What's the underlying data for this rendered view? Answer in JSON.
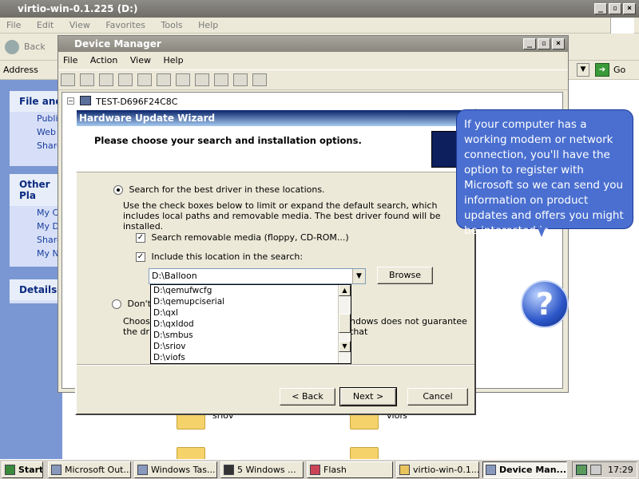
{
  "explorer": {
    "title": "virtio-win-0.1.225 (D:)",
    "menu": [
      "File",
      "Edit",
      "View",
      "Favorites",
      "Tools",
      "Help"
    ],
    "back_label": "Back",
    "address_label": "Address",
    "go_label": "Go",
    "file_tasks_title": "File and",
    "file_tasks": [
      "Publis",
      "Web",
      "Share"
    ],
    "other_places_title": "Other Pla",
    "other_places": [
      "My C",
      "My D",
      "Share",
      "My N"
    ],
    "details_title": "Details",
    "folders": [
      "sriov",
      "viofs"
    ]
  },
  "device_manager": {
    "title": "Device Manager",
    "menu": [
      "File",
      "Action",
      "View",
      "Help"
    ],
    "tree_root": "TEST-D696F24C8C"
  },
  "wizard": {
    "title": "Hardware Update Wizard",
    "heading": "Please choose your search and installation options.",
    "option1_label": "Search for the best driver in these locations.",
    "option1_desc": "Use the check boxes below to limit or expand the default search, which includes local paths and removable media. The best driver found will be installed.",
    "check1_label": "Search removable media (floppy, CD-ROM...)",
    "check2_label": "Include this location in the search:",
    "location_value": "D:\\Balloon",
    "browse_label": "Browse",
    "dropdown_items": [
      "D:\\qemufwcfg",
      "D:\\qemupciserial",
      "D:\\qxl",
      "D:\\qxldod",
      "D:\\smbus",
      "D:\\sriov",
      "D:\\viofs"
    ],
    "option2_label": "Don't",
    "option2_desc_start": "Choos",
    "option2_desc_start2": "the dri",
    "option2_desc_end": "ndows does not guarantee that",
    "back_label": "< Back",
    "next_label": "Next >",
    "cancel_label": "Cancel"
  },
  "balloon": {
    "text": "If your computer has a working modem or network connection, you'll have the option to register with Microsoft so we can send you information on product updates and offers you might be interested in."
  },
  "help": {
    "glyph": "?"
  },
  "taskbar": {
    "start_label": "Start",
    "buttons": [
      "Microsoft Out...",
      "Windows Tas...",
      "5 Windows ...",
      "Flash",
      "virtio-win-0.1...",
      "Device Man..."
    ],
    "clock": "17:29"
  }
}
